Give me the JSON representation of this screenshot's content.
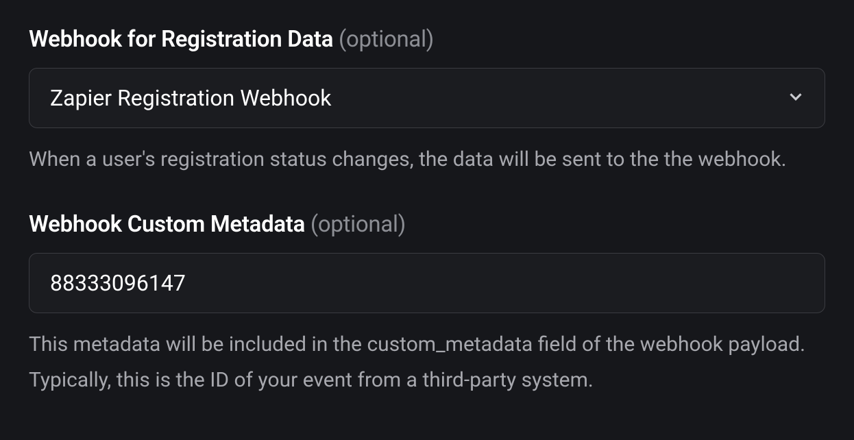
{
  "webhook_registration": {
    "label": "Webhook for Registration Data",
    "optional_suffix": " (optional)",
    "selected_value": "Zapier Registration Webhook",
    "helper": "When a user's registration status changes, the data will be sent to the the webhook."
  },
  "webhook_metadata": {
    "label": "Webhook Custom Metadata",
    "optional_suffix": " (optional)",
    "value": "88333096147",
    "helper": "This metadata will be included in the custom_metadata field of the webhook payload. Typically, this is the ID of your event from a third-party system."
  }
}
